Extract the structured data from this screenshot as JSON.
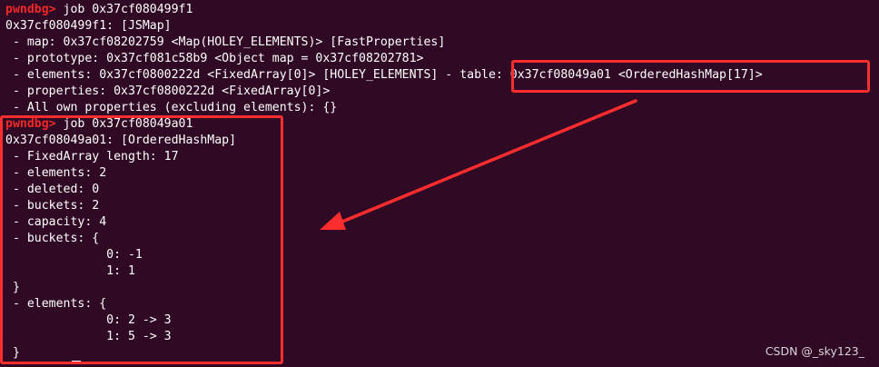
{
  "terminal": {
    "prompt": "pwndbg>",
    "lines": [
      {
        "type": "prompt",
        "command": " job 0x37cf080499f1"
      },
      {
        "type": "text",
        "text": "0x37cf080499f1: [JSMap]"
      },
      {
        "type": "text",
        "text": " - map: 0x37cf08202759 <Map(HOLEY_ELEMENTS)> [FastProperties]"
      },
      {
        "type": "text",
        "text": " - prototype: 0x37cf081c58b9 <Object map = 0x37cf08202781>"
      },
      {
        "type": "text",
        "text": " - elements: 0x37cf0800222d <FixedArray[0]> [HOLEY_ELEMENTS] - table: 0x37cf08049a01 <OrderedHashMap[17]>"
      },
      {
        "type": "text",
        "text": " - properties: 0x37cf0800222d <FixedArray[0]>"
      },
      {
        "type": "text",
        "text": " - All own properties (excluding elements): {}"
      },
      {
        "type": "prompt",
        "command": " job 0x37cf08049a01"
      },
      {
        "type": "text",
        "text": "0x37cf08049a01: [OrderedHashMap]"
      },
      {
        "type": "text",
        "text": " - FixedArray length: 17"
      },
      {
        "type": "text",
        "text": " - elements: 2"
      },
      {
        "type": "text",
        "text": " - deleted: 0"
      },
      {
        "type": "text",
        "text": " - buckets: 2"
      },
      {
        "type": "text",
        "text": " - capacity: 4"
      },
      {
        "type": "text",
        "text": " - buckets: {"
      },
      {
        "type": "text",
        "text": "              0: -1"
      },
      {
        "type": "text",
        "text": "              1: 1"
      },
      {
        "type": "text",
        "text": " }"
      },
      {
        "type": "text",
        "text": " - elements: {"
      },
      {
        "type": "text",
        "text": "              0: 2 -> 3"
      },
      {
        "type": "text",
        "text": "              1: 5 -> 3"
      },
      {
        "type": "text",
        "text": " }"
      }
    ]
  },
  "annotation_color": "#ff2d2d",
  "watermark": "CSDN @_sky123_"
}
